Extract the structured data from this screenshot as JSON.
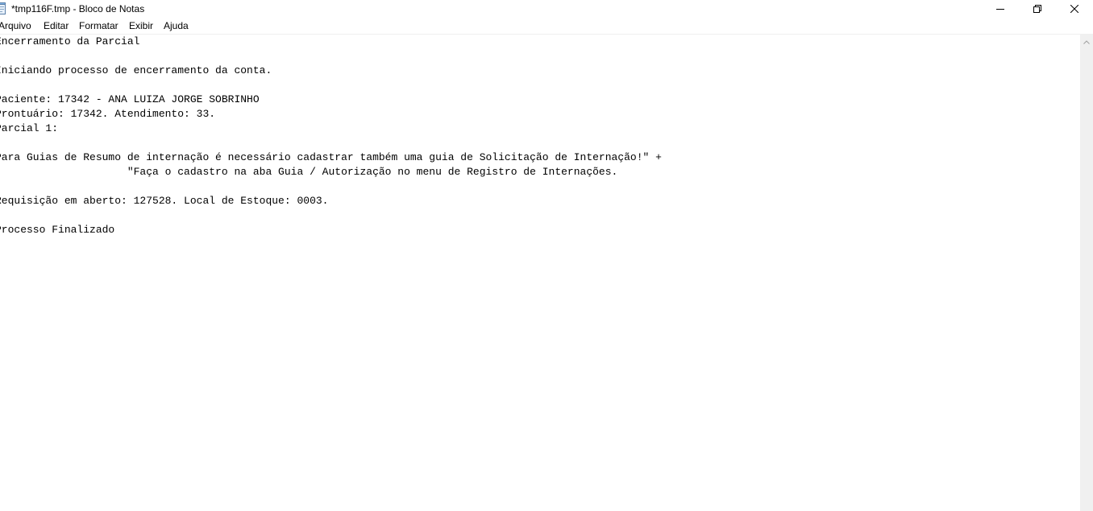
{
  "window": {
    "title": "*tmp116F.tmp - Bloco de Notas",
    "icons": {
      "app": "notepad-icon",
      "minimize": "minimize-icon",
      "maximize": "restore-icon",
      "close": "close-icon"
    }
  },
  "menu": {
    "items": [
      "Arquivo",
      "Editar",
      "Formatar",
      "Exibir",
      "Ajuda"
    ]
  },
  "editor": {
    "content": "Encerramento da Parcial\n\nIniciando processo de encerramento da conta.\n\nPaciente: 17342 - ANA LUIZA JORGE SOBRINHO\nProntuário: 17342. Atendimento: 33.\nParcial 1:\n\nPara Guias de Resumo de internação é necessário cadastrar também uma guia de Solicitação de Internação!\" +\n                     \"Faça o cadastro na aba Guia / Autorização no menu de Registro de Internações.\n\nRequisição em aberto: 127528. Local de Estoque: 0003.\n\nProcesso Finalizado"
  },
  "colors": {
    "background": "#ffffff",
    "text": "#000000",
    "scrollbar": "#f0f0f0"
  }
}
